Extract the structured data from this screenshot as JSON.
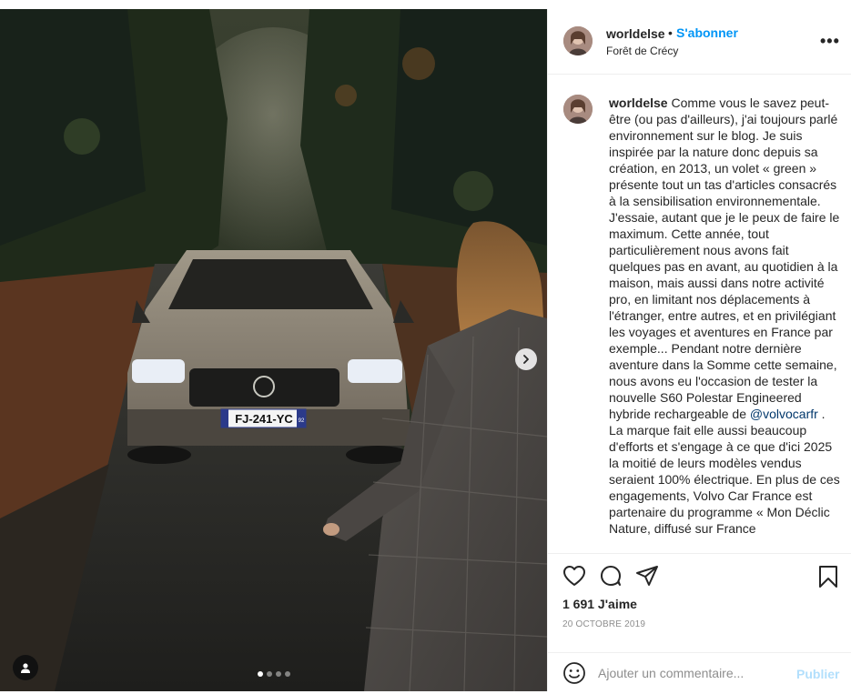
{
  "post": {
    "username": "worldelse",
    "bullet": "•",
    "follow_label": "S'abonner",
    "location": "Forêt de Crécy",
    "more_label": "•••"
  },
  "caption": {
    "username": "worldelse",
    "text_before_mention": " Comme vous le savez peut-être (ou pas d'ailleurs), j'ai toujours parlé environnement sur le blog. Je suis inspirée par la nature donc depuis sa création, en 2013, un volet « green » présente tout un tas d'articles consacrés à la sensibilisation environnementale. J'essaie, autant que je le peux de faire le maximum. Cette année, tout particulièrement nous avons fait quelques pas en avant, au quotidien à la maison, mais aussi dans notre activité pro, en limitant nos déplacements à l'étranger, entre autres, et en privilégiant les voyages et aventures en France par exemple... Pendant notre dernière aventure dans la Somme cette semaine, nous avons eu l'occasion de tester la nouvelle S60 Polestar Engineered hybride rechargeable de ",
    "mention": "@volvocarfr",
    "text_after_mention": " . La marque fait elle aussi beaucoup d'efforts et s'engage à ce que d'ici 2025 la moitié de leurs modèles vendus seraient 100% électrique. En plus de ces engagements, Volvo Car France est partenaire du programme « Mon Déclic Nature, diffusé sur France"
  },
  "photo": {
    "license_plate": "FJ-241-YC",
    "plate_region": "92",
    "carousel_dots": 4,
    "active_dot": 0
  },
  "stats": {
    "likes": "1 691 J'aime",
    "date": "20 OCTOBRE 2019"
  },
  "comment": {
    "placeholder": "Ajouter un commentaire...",
    "publish_label": "Publier"
  },
  "colors": {
    "accent": "#0095f6",
    "publish_disabled": "#b2dffc",
    "text": "#262626",
    "muted": "#8e8e8e"
  }
}
